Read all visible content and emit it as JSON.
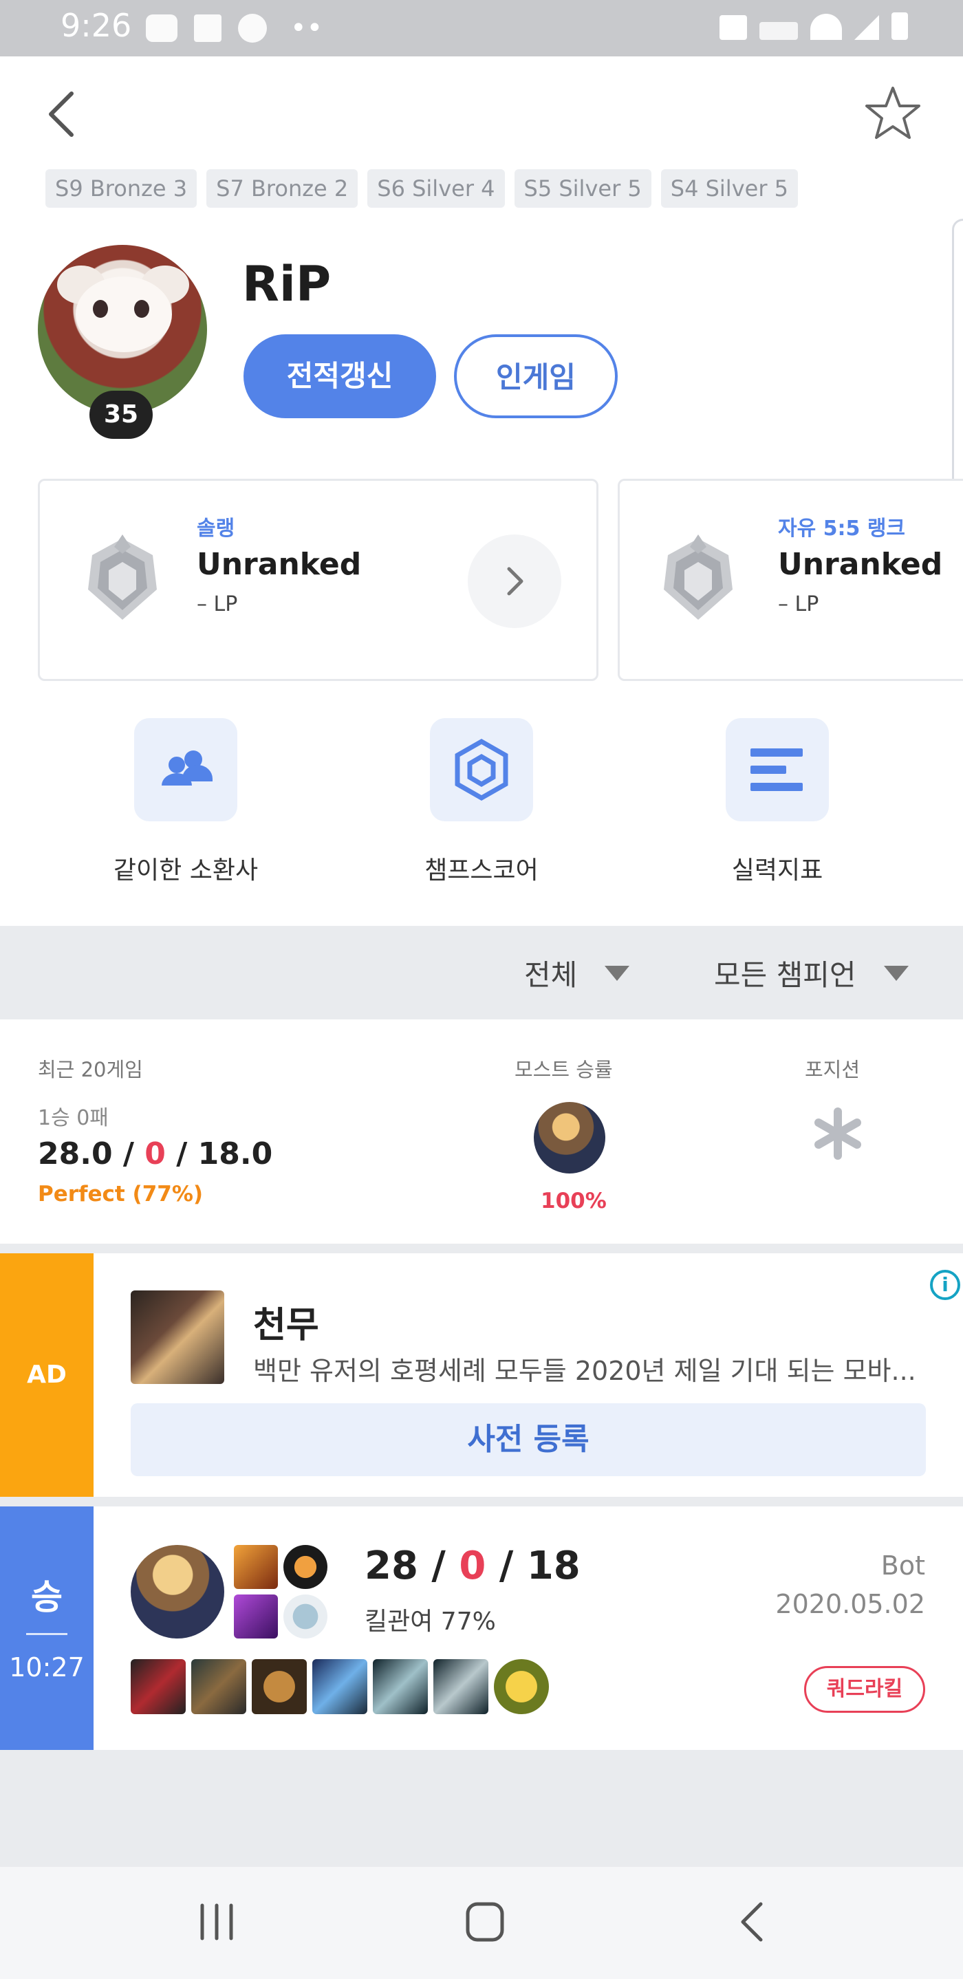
{
  "status_bar": {
    "time": "9:26",
    "left_icons": [
      "talk-icon",
      "gallery-icon",
      "naver-icon"
    ],
    "more": "••"
  },
  "seasons": [
    "S9  Bronze 3",
    "S7  Bronze 2",
    "S6  Silver 4",
    "S5  Silver 5",
    "S4  Silver 5"
  ],
  "profile": {
    "name": "RiP",
    "level": "35",
    "refresh_label": "전적갱신",
    "ingame_label": "인게임"
  },
  "ranks": [
    {
      "type": "솔랭",
      "tier": "Unranked",
      "lp": "– LP"
    },
    {
      "type": "자유 5:5 랭크",
      "tier": "Unranked",
      "lp": "– LP"
    }
  ],
  "quick_menu": [
    {
      "label": "같이한 소환사",
      "icon": "people-icon"
    },
    {
      "label": "챔프스코어",
      "icon": "hexagon-icon"
    },
    {
      "label": "실력지표",
      "icon": "bars-icon"
    }
  ],
  "filters": {
    "queue": "전체",
    "champion": "모든 챔피언"
  },
  "summary": {
    "recent_label": "최근 20게임",
    "most_label": "모스트 승률",
    "position_label": "포지션",
    "record": "1승 0패",
    "kills": "28.0",
    "deaths": "0",
    "assists": "18.0",
    "sep": " / ",
    "perfect": "Perfect  (77%)",
    "most_rate": "100%"
  },
  "ad": {
    "badge": "AD",
    "title": "천무",
    "description": "백만 유저의 호평세례 모두들 2020년 제일 기대 되는 모바...",
    "cta": "사전 등록",
    "info": "i"
  },
  "match": {
    "result": "승",
    "duration": "10:27",
    "kills": "28",
    "deaths": "0",
    "assists": "18",
    "sep": " / ",
    "kill_participation": "킬관여 77%",
    "mode": "Bot",
    "date": "2020.05.02",
    "multikill": "쿼드라킬"
  },
  "colors": {
    "accent": "#5383e8",
    "red": "#e84057",
    "orange": "#f28a16",
    "ad": "#fba510"
  }
}
